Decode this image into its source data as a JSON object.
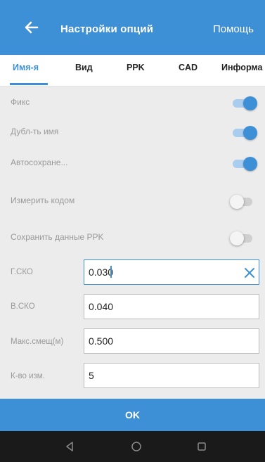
{
  "header": {
    "title": "Настройки опций",
    "help_label": "Помощь",
    "back_icon": "arrow-left-icon"
  },
  "tabs": [
    {
      "label": "Имя-я",
      "active": true
    },
    {
      "label": "Вид",
      "active": false
    },
    {
      "label": "PPK",
      "active": false
    },
    {
      "label": "CAD",
      "active": false
    },
    {
      "label": "Информа",
      "active": false
    }
  ],
  "toggles": [
    {
      "label": "Фикс",
      "on": true
    },
    {
      "label": "Дубл-ть имя",
      "on": true
    },
    {
      "label": "Автосохране...",
      "on": true
    },
    {
      "label": "Измерить кодом",
      "on": false
    },
    {
      "label": "Сохранить данные PPK",
      "on": false
    }
  ],
  "fields": [
    {
      "label": "Г.СКО",
      "value": "0.030",
      "focused": true
    },
    {
      "label": "В.СКО",
      "value": "0.040",
      "focused": false
    },
    {
      "label": "Макс.смещ(м)",
      "value": "0.500",
      "focused": false
    },
    {
      "label": "К-во изм.",
      "value": "5",
      "focused": false
    }
  ],
  "footer": {
    "ok_label": "OK"
  },
  "colors": {
    "accent": "#3d8fd6",
    "background": "#ececec",
    "navbar": "#1a1a1a"
  }
}
